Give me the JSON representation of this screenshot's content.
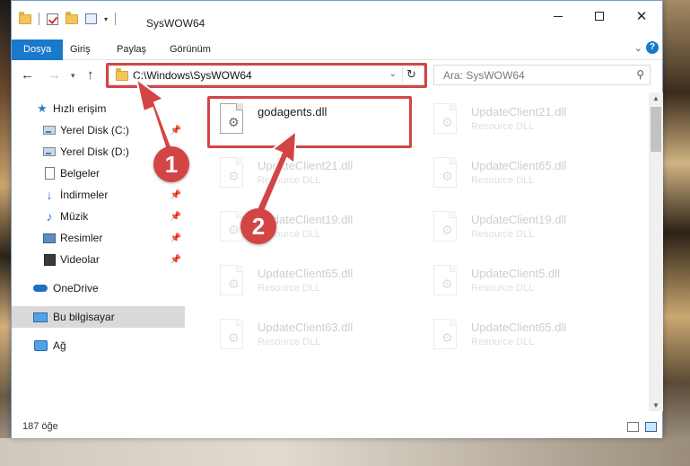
{
  "window": {
    "title": "SysWOW64"
  },
  "ribbon": {
    "tabs": [
      {
        "label": "Dosya"
      },
      {
        "label": "Giriş"
      },
      {
        "label": "Paylaş"
      },
      {
        "label": "Görünüm"
      }
    ]
  },
  "address": {
    "path": "C:\\Windows\\SysWOW64"
  },
  "search": {
    "placeholder": "Ara: SysWOW64"
  },
  "sidebar": {
    "items": [
      {
        "label": "Hızlı erişim",
        "icon": "star-icon"
      },
      {
        "label": "Yerel Disk (C:)",
        "icon": "drive-icon",
        "pinned": true
      },
      {
        "label": "Yerel Disk (D:)",
        "icon": "drive-icon"
      },
      {
        "label": "Belgeler",
        "icon": "document-icon"
      },
      {
        "label": "İndirmeler",
        "icon": "download-icon",
        "pinned": true
      },
      {
        "label": "Müzik",
        "icon": "music-icon",
        "pinned": true
      },
      {
        "label": "Resimler",
        "icon": "picture-icon",
        "pinned": true
      },
      {
        "label": "Videolar",
        "icon": "video-icon",
        "pinned": true
      },
      {
        "label": "OneDrive",
        "icon": "cloud-icon"
      },
      {
        "label": "Bu bilgisayar",
        "icon": "computer-icon",
        "selected": true
      },
      {
        "label": "Ağ",
        "icon": "network-icon"
      }
    ]
  },
  "files": [
    {
      "name": "godagents.dll",
      "type": "",
      "highlighted": true
    },
    {
      "name": "UpdateClient21.dll",
      "type": "Resource DLL"
    },
    {
      "name": "UpdateClient21.dll",
      "type": "Resource DLL"
    },
    {
      "name": "UpdateClient65.dll",
      "type": "Resource DLL"
    },
    {
      "name": "UpdateClient19.dll",
      "type": "Resource DLL"
    },
    {
      "name": "UpdateClient19.dll",
      "type": "Resource DLL"
    },
    {
      "name": "UpdateClient65.dll",
      "type": "Resource DLL"
    },
    {
      "name": "UpdateClient5.dll",
      "type": "Resource DLL"
    },
    {
      "name": "UpdateClient63.dll",
      "type": "Resource DLL"
    },
    {
      "name": "UpdateClient65.dll",
      "type": "Resource DLL"
    }
  ],
  "status": {
    "item_count": "187 öğe"
  },
  "callouts": [
    {
      "label": "1"
    },
    {
      "label": "2"
    }
  ],
  "colors": {
    "accent": "#1979ca",
    "annotation_red": "#d34545",
    "selection": "#cce8ff"
  }
}
